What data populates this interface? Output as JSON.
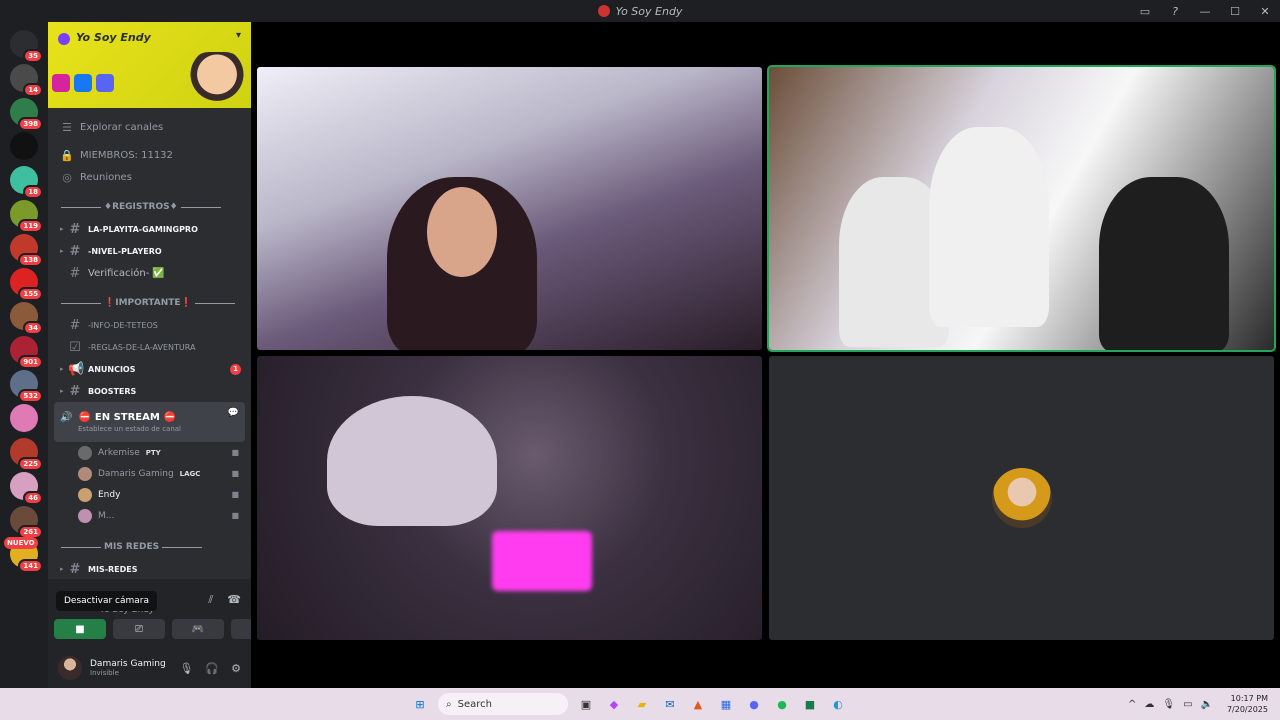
{
  "title": "Yo Soy Endy",
  "server_badges": [
    "35",
    "14",
    "398",
    "",
    "18",
    "119",
    "138",
    "155",
    "34",
    "901",
    "532",
    "",
    "225",
    "46",
    "261",
    "141"
  ],
  "server_colors": [
    "#2b2d31",
    "#4a4a4a",
    "#2f7d4a",
    "#111111",
    "#3fbfa0",
    "#7a9a2a",
    "#c0392b",
    "#d22",
    "#8a5a3a",
    "#aa2233",
    "#5f6f8a",
    "#e07ab5",
    "#b23a2a",
    "#d8a0c0",
    "#6a4a3a",
    "#e0b020"
  ],
  "nuevo": "NUEVO",
  "server_name": "Yo Soy Endy",
  "browse": "Explorar canales",
  "members": "MIEMBROS: 11132",
  "meetings": "Reuniones",
  "cat_registros": "REGISTROS",
  "ch_playita": "LA-PLAYITA-GAMINGPRO",
  "ch_nivel": "-NIVEL-PLAYERO",
  "ch_verif": "Verificación-",
  "cat_importante": "IMPORTANTE",
  "ch_info": "-INFO-DE-TETEOS",
  "ch_reglas": "-REGLAS-DE-LA-AVENTURA",
  "ch_anuncios": "ANUNCIOS",
  "anuncios_badge": "1",
  "ch_boosters": "BOOSTERS",
  "ch_stream": "EN STREAM",
  "stream_status": "Establece un estado de canal",
  "voice_users": [
    {
      "name": "Arkemise",
      "tag": "PTY",
      "color": "#6a6a6a"
    },
    {
      "name": "Damaris Gaming",
      "tag": "LAGC",
      "color": "#b08a7a"
    },
    {
      "name": "Endy",
      "tag": "",
      "color": "#caa070"
    },
    {
      "name": "M...",
      "tag": "",
      "color": "#c090b0"
    }
  ],
  "cat_redes": "MIS REDES",
  "ch_misredes": "MIS-REDES",
  "tooltip": "Desactivar cámara",
  "voice_server": "Yo Soy Endy",
  "user_name": "Damaris Gaming",
  "user_status": "Invisible",
  "search": "Search",
  "time": "10:17 PM",
  "date": "7/20/2025"
}
